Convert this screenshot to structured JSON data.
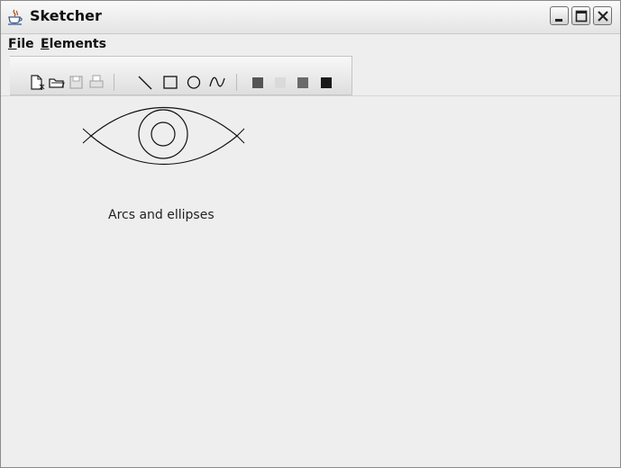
{
  "app": {
    "title": "Sketcher",
    "icon": "java-cup-icon"
  },
  "window_controls": {
    "minimize": "minimize-icon",
    "maximize": "maximize-icon",
    "close": "close-icon"
  },
  "menubar": {
    "items": [
      {
        "label": "File",
        "mnemonic": "F"
      },
      {
        "label": "Elements",
        "mnemonic": "E"
      }
    ]
  },
  "toolbar": {
    "file_group": [
      {
        "name": "new",
        "icon": "new-file-icon",
        "enabled": true
      },
      {
        "name": "open",
        "icon": "open-folder-icon",
        "enabled": true
      },
      {
        "name": "save",
        "icon": "save-disk-icon",
        "enabled": false
      },
      {
        "name": "print",
        "icon": "printer-icon",
        "enabled": false
      }
    ],
    "element_group": [
      {
        "name": "line",
        "icon": "line-icon"
      },
      {
        "name": "rectangle",
        "icon": "rectangle-icon"
      },
      {
        "name": "circle",
        "icon": "circle-icon"
      },
      {
        "name": "curve",
        "icon": "curve-icon"
      }
    ],
    "color_group": [
      {
        "name": "red",
        "icon": "color-swatch-icon",
        "swatch": "#555555"
      },
      {
        "name": "yellow",
        "icon": "color-swatch-icon",
        "swatch": "#dadada"
      },
      {
        "name": "green",
        "icon": "color-swatch-icon",
        "swatch": "#6a6a6a"
      },
      {
        "name": "blue",
        "icon": "color-swatch-icon",
        "swatch": "#1a1a1a"
      }
    ]
  },
  "canvas": {
    "caption": "Arcs and ellipses",
    "drawing": "eye-shaped-ellipse-drawing"
  }
}
